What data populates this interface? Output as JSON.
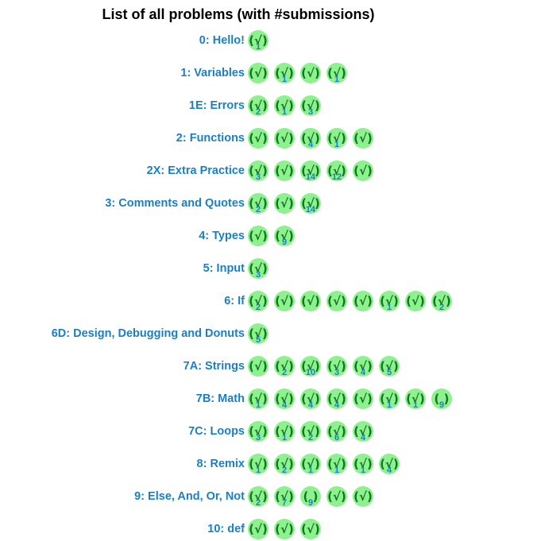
{
  "title": "List of all problems (with #submissions)",
  "problems": [
    {
      "label": "0: Hello!",
      "badges": [
        {
          "mark": "(√)",
          "count": "1"
        }
      ]
    },
    {
      "label": "1: Variables",
      "badges": [
        {
          "mark": "(√)",
          "count": ""
        },
        {
          "mark": "(√)",
          "count": "1"
        },
        {
          "mark": "(√)",
          "count": ""
        },
        {
          "mark": "(√)",
          "count": "1"
        }
      ]
    },
    {
      "label": "1E: Errors",
      "badges": [
        {
          "mark": "(√)",
          "count": "2"
        },
        {
          "mark": "(√)",
          "count": "1"
        },
        {
          "mark": "(√)",
          "count": "3"
        }
      ]
    },
    {
      "label": "2: Functions",
      "badges": [
        {
          "mark": "(√)",
          "count": ""
        },
        {
          "mark": "(√)",
          "count": ""
        },
        {
          "mark": "(√)",
          "count": "4"
        },
        {
          "mark": "(√)",
          "count": "1"
        },
        {
          "mark": "(√)",
          "count": ""
        }
      ]
    },
    {
      "label": "2X: Extra Practice",
      "badges": [
        {
          "mark": "(√)",
          "count": "3"
        },
        {
          "mark": "(√)",
          "count": ""
        },
        {
          "mark": "(√)",
          "count": "14"
        },
        {
          "mark": "(√)",
          "count": "12"
        },
        {
          "mark": "(√)",
          "count": ""
        }
      ]
    },
    {
      "label": "3: Comments and Quotes",
      "badges": [
        {
          "mark": "(√)",
          "count": "2"
        },
        {
          "mark": "(√)",
          "count": ""
        },
        {
          "mark": "(√)",
          "count": "14"
        }
      ]
    },
    {
      "label": "4: Types",
      "badges": [
        {
          "mark": "(√)",
          "count": ""
        },
        {
          "mark": "(√)",
          "count": "9"
        }
      ]
    },
    {
      "label": "5: Input",
      "badges": [
        {
          "mark": "(√)",
          "count": "3"
        }
      ]
    },
    {
      "label": "6: If",
      "badges": [
        {
          "mark": "(√)",
          "count": "2"
        },
        {
          "mark": "(√)",
          "count": ""
        },
        {
          "mark": "(√)",
          "count": ""
        },
        {
          "mark": "(√)",
          "count": ""
        },
        {
          "mark": "(√)",
          "count": ""
        },
        {
          "mark": "(√)",
          "count": "1"
        },
        {
          "mark": "(√)",
          "count": ""
        },
        {
          "mark": "(√)",
          "count": "2"
        }
      ]
    },
    {
      "label": "6D: Design, Debugging and Donuts",
      "badges": [
        {
          "mark": "(√)",
          "count": "5"
        }
      ]
    },
    {
      "label": "7A: Strings",
      "badges": [
        {
          "mark": "(√)",
          "count": ""
        },
        {
          "mark": "(√)",
          "count": "2"
        },
        {
          "mark": "(√)",
          "count": "10"
        },
        {
          "mark": "(√)",
          "count": "3"
        },
        {
          "mark": "(√)",
          "count": "4"
        },
        {
          "mark": "(√)",
          "count": "5"
        }
      ]
    },
    {
      "label": "7B: Math",
      "badges": [
        {
          "mark": "(√)",
          "count": "1"
        },
        {
          "mark": "(√)",
          "count": "4"
        },
        {
          "mark": "(√)",
          "count": "4"
        },
        {
          "mark": "(√)",
          "count": "4"
        },
        {
          "mark": "(√)",
          "count": ""
        },
        {
          "mark": "(√)",
          "count": "1"
        },
        {
          "mark": "(√)",
          "count": "1"
        },
        {
          "mark": "( )",
          "count": "9"
        }
      ]
    },
    {
      "label": "7C: Loops",
      "badges": [
        {
          "mark": "(√)",
          "count": "3"
        },
        {
          "mark": "(√)",
          "count": "1"
        },
        {
          "mark": "(√)",
          "count": "2"
        },
        {
          "mark": "(√)",
          "count": "6"
        },
        {
          "mark": "(√)",
          "count": "4"
        }
      ]
    },
    {
      "label": "8: Remix",
      "badges": [
        {
          "mark": "(√)",
          "count": "1"
        },
        {
          "mark": "(√)",
          "count": "2"
        },
        {
          "mark": "(√)",
          "count": "1"
        },
        {
          "mark": "(√)",
          "count": "1"
        },
        {
          "mark": "(√)",
          "count": "1"
        },
        {
          "mark": "(√)",
          "count": "4"
        }
      ]
    },
    {
      "label": "9: Else, And, Or, Not",
      "badges": [
        {
          "mark": "(√)",
          "count": "2"
        },
        {
          "mark": "(√)",
          "count": "7"
        },
        {
          "mark": "( )",
          "count": "9"
        },
        {
          "mark": "(√)",
          "count": ""
        },
        {
          "mark": "(√)",
          "count": ""
        }
      ]
    },
    {
      "label": "10: def",
      "badges": [
        {
          "mark": "(√)",
          "count": ""
        },
        {
          "mark": "(√)",
          "count": ""
        },
        {
          "mark": "(√)",
          "count": ""
        }
      ]
    }
  ]
}
